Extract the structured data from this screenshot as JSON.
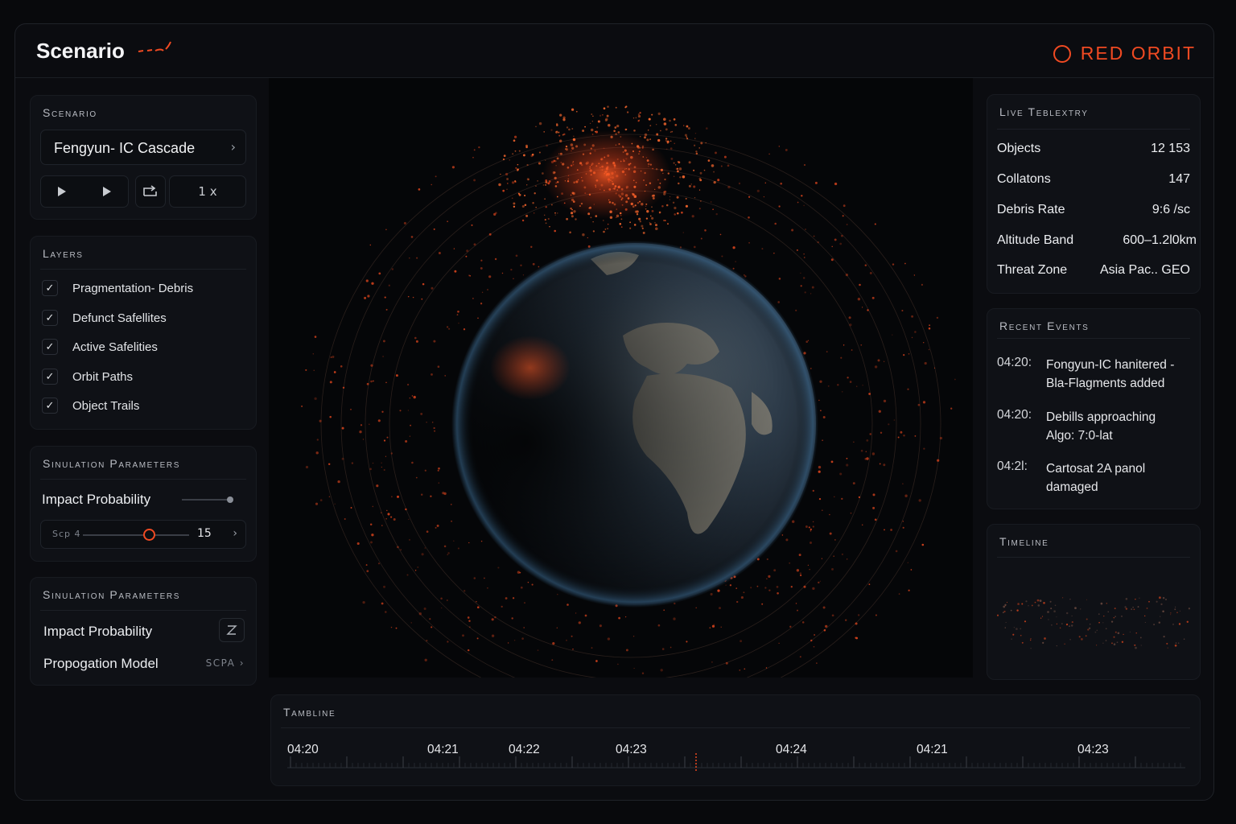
{
  "header": {
    "title": "Scenario",
    "brand": "RED ORBIT",
    "accent": "#f04a22"
  },
  "scenario": {
    "panel_title": "Scenario",
    "selected": "Fengyun- IC Cascade",
    "speed": "1 x",
    "icons": [
      "play-icon",
      "step-forward-icon",
      "repeat-icon"
    ]
  },
  "layers": {
    "panel_title": "Layers",
    "items": [
      {
        "label": "Pragmentation- Debris",
        "checked": true
      },
      {
        "label": "Defunct Safellites",
        "checked": true
      },
      {
        "label": "Active Safelities",
        "checked": true
      },
      {
        "label": "Orbit Paths",
        "checked": true
      },
      {
        "label": "Object Trails",
        "checked": true
      }
    ]
  },
  "sim_params_1": {
    "panel_title": "Sinulation Parameters",
    "impact_label": "Impact Probability",
    "slider_label": "Scp 4",
    "slider_value": "15",
    "slider_fraction": 0.62
  },
  "sim_params_2": {
    "panel_title": "Sinulation Parameters",
    "impact_label": "Impact Probability",
    "model_label": "Propogation Model",
    "model_value": "SCPA"
  },
  "telemetry": {
    "panel_title": "Live Teblextry",
    "rows": [
      {
        "label": "Objects",
        "value": "12 153"
      },
      {
        "label": "Collatons",
        "value": "147"
      },
      {
        "label": "Debris Rate",
        "value": "9:6 /sc"
      },
      {
        "label": "Altitude Band",
        "value": "600–1.2l0km"
      },
      {
        "label": "Threat Zone",
        "value": "Asia Pac.. GEO"
      }
    ]
  },
  "events": {
    "panel_title": "Recent Events",
    "items": [
      {
        "time": "04:20:",
        "line1": "Fongyun-IC hanitered -",
        "line2": "Bla-Flagments added"
      },
      {
        "time": "04:20:",
        "line1": "Debills approaching",
        "line2": "Algo: 7:0-lat"
      },
      {
        "time": "04:2l:",
        "line1": "Cartosat  2A panol",
        "line2": "damaged"
      }
    ]
  },
  "timeline_panel": {
    "panel_title": "Timeline"
  },
  "bottom_timeline": {
    "panel_title": "Tambline",
    "labels": [
      "04:20",
      "04:21",
      "04:22",
      "04:23",
      "04:24",
      "04:21",
      "04:23"
    ]
  }
}
